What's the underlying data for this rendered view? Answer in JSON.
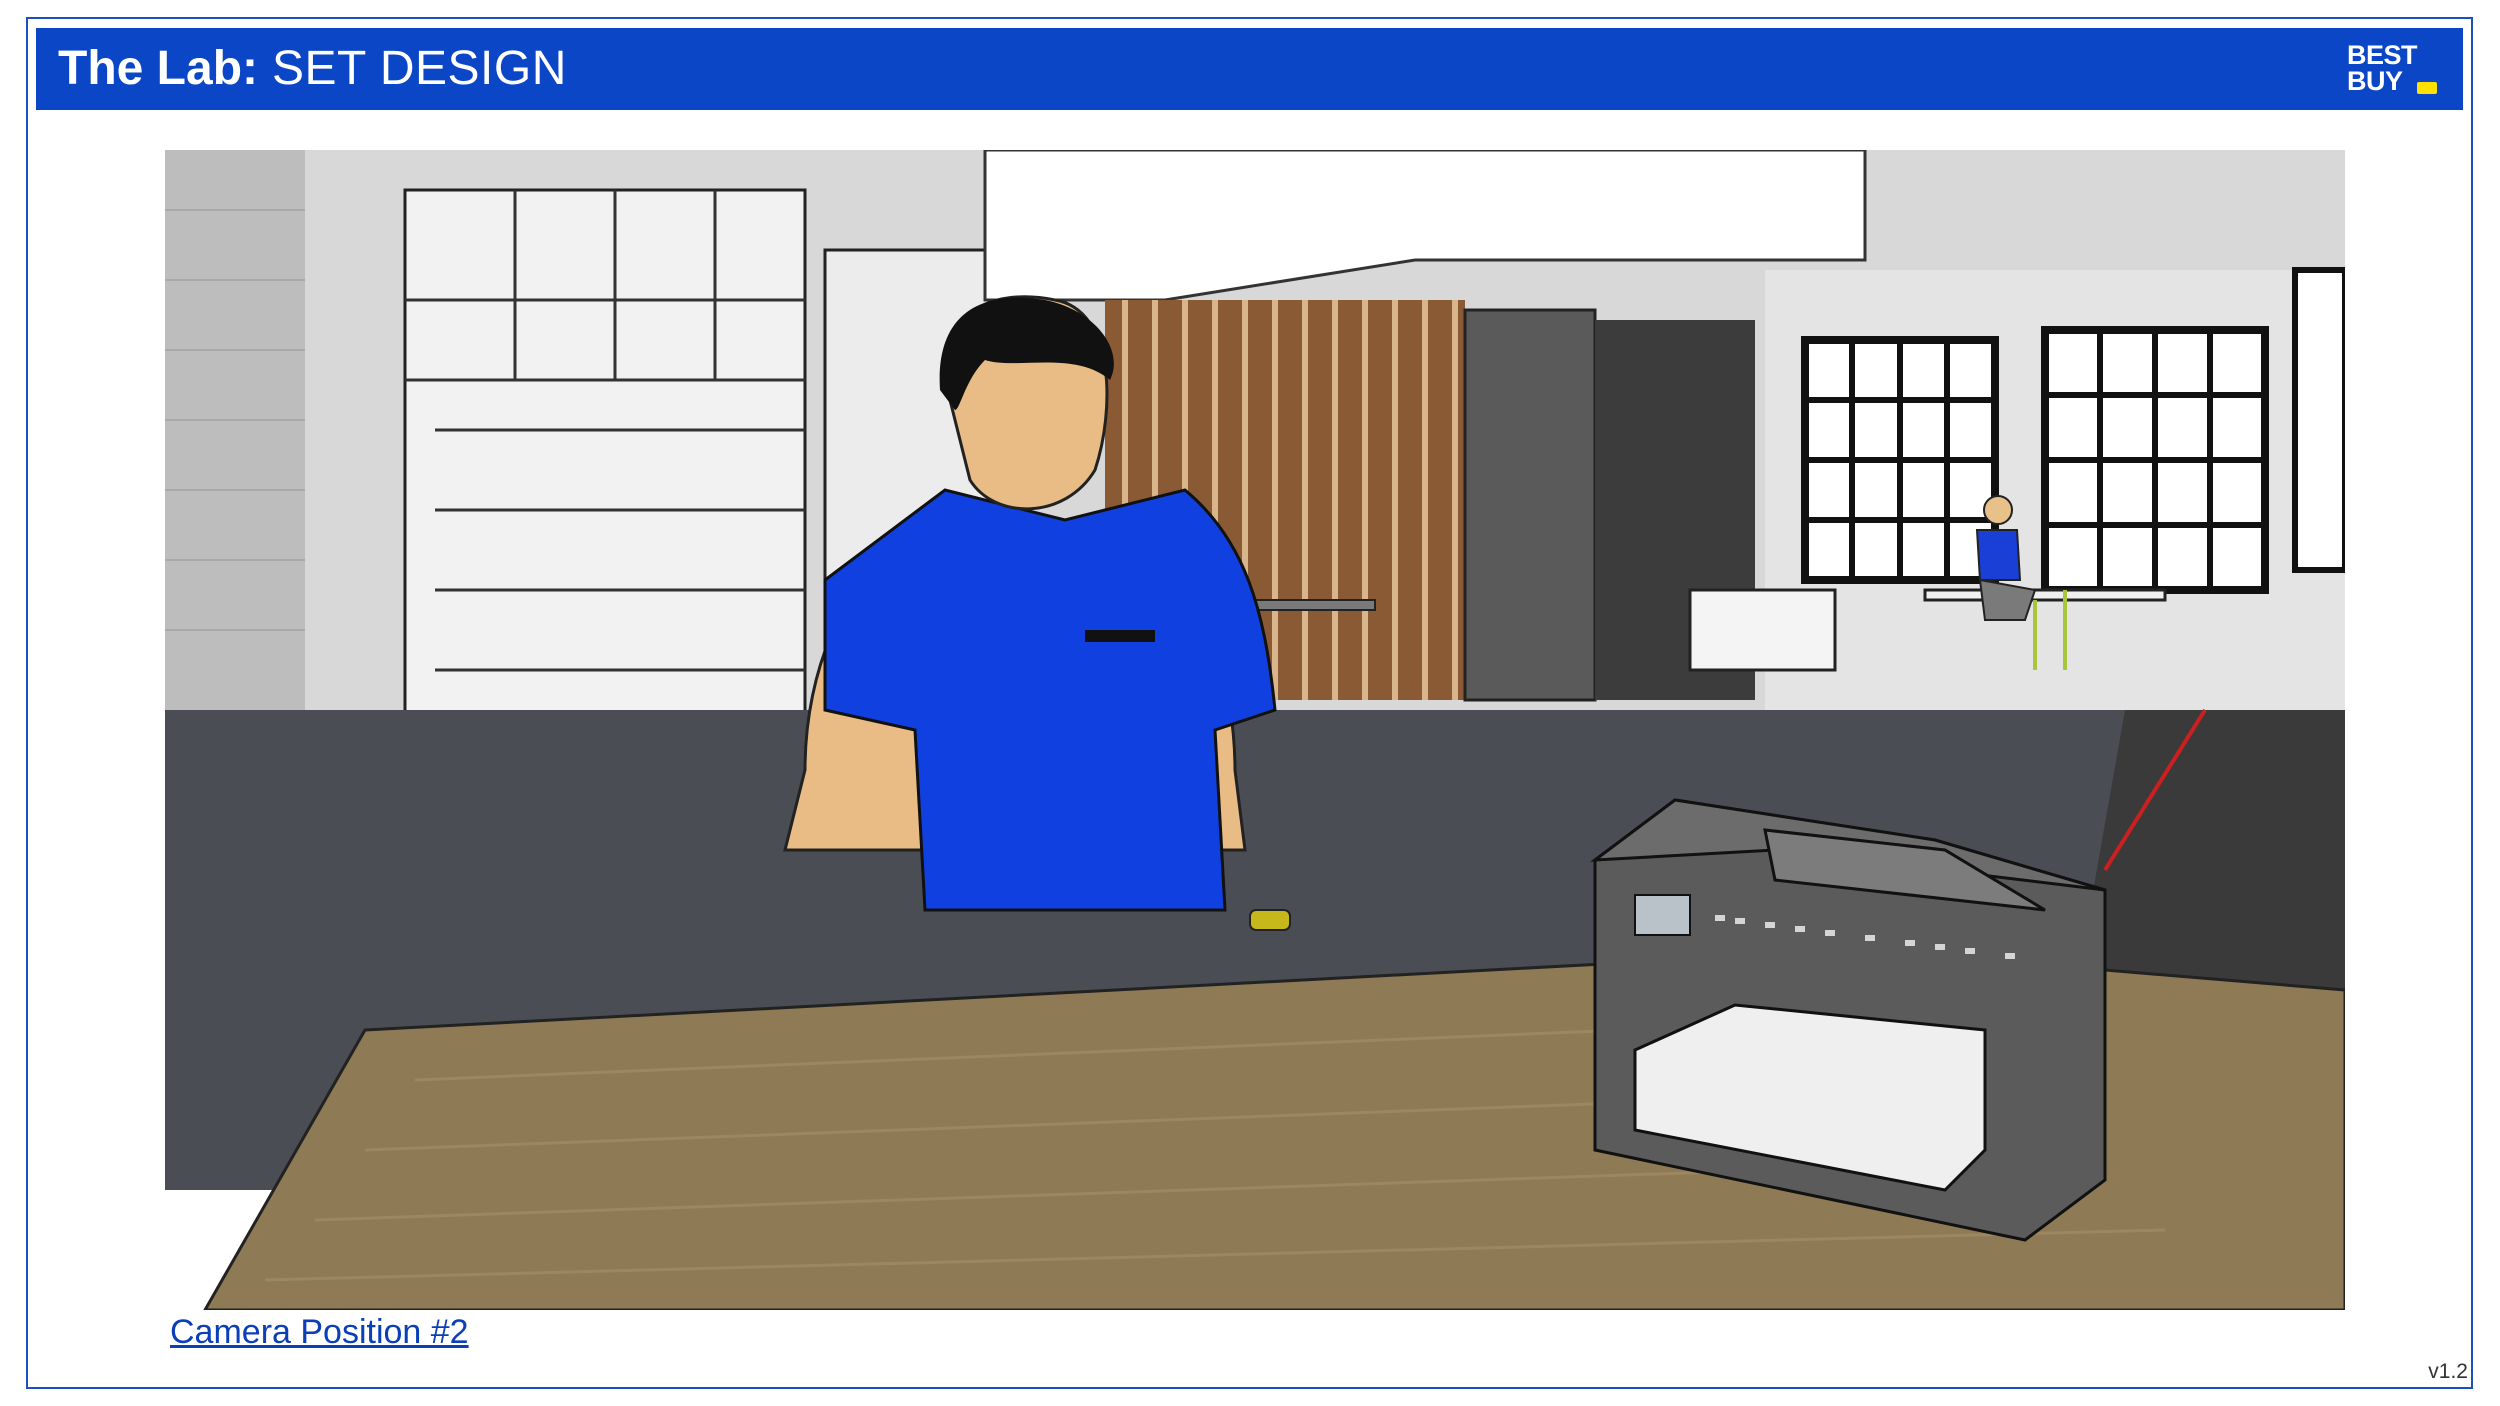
{
  "header": {
    "title_bold": "The Lab:",
    "title_light": "SET DESIGN",
    "logo_text_line1": "BEST",
    "logo_text_line2": "BUY",
    "brand_color": "#0a46c6",
    "logo_tag_color": "#ffe000"
  },
  "scene": {
    "caption": "Camera Position #2"
  },
  "footer": {
    "version": "v1.2"
  }
}
